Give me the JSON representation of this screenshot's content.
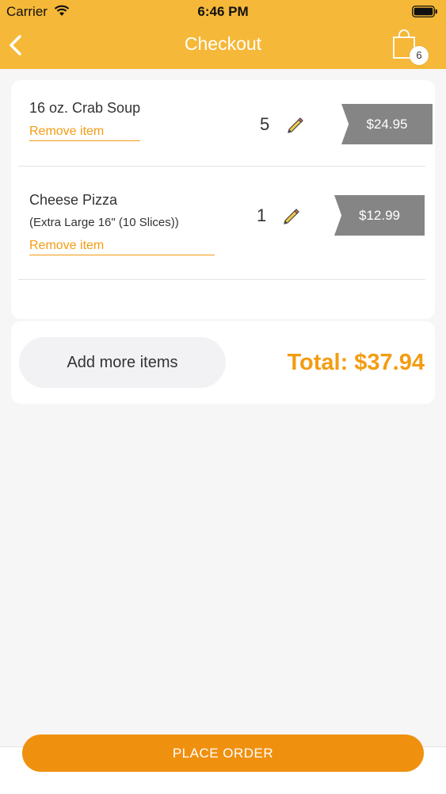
{
  "status_bar": {
    "carrier": "Carrier",
    "time": "6:46 PM",
    "icons": [
      "wifi-icon",
      "battery-icon"
    ]
  },
  "header": {
    "title": "Checkout",
    "back_icon": "chevron-left-icon",
    "cart_icon": "shopping-bag-icon",
    "cart_count": "6"
  },
  "items": [
    {
      "name": "16 oz. Crab Soup",
      "option": "",
      "remove_label": "Remove item",
      "quantity": "5",
      "price": "$24.95"
    },
    {
      "name": "Cheese Pizza",
      "option": "(Extra Large 16\" (10 Slices))",
      "remove_label": "Remove item",
      "quantity": "1",
      "price": "$12.99"
    }
  ],
  "summary": {
    "add_more_label": "Add more items",
    "total_label": "Total: $37.94"
  },
  "footer": {
    "place_order_label": "PLACE ORDER"
  },
  "colors": {
    "header_bg": "#f6b838",
    "accent": "#f39c12",
    "button_bg": "#f0900f",
    "price_tag": "#858585",
    "page_bg": "#f6f6f7"
  }
}
